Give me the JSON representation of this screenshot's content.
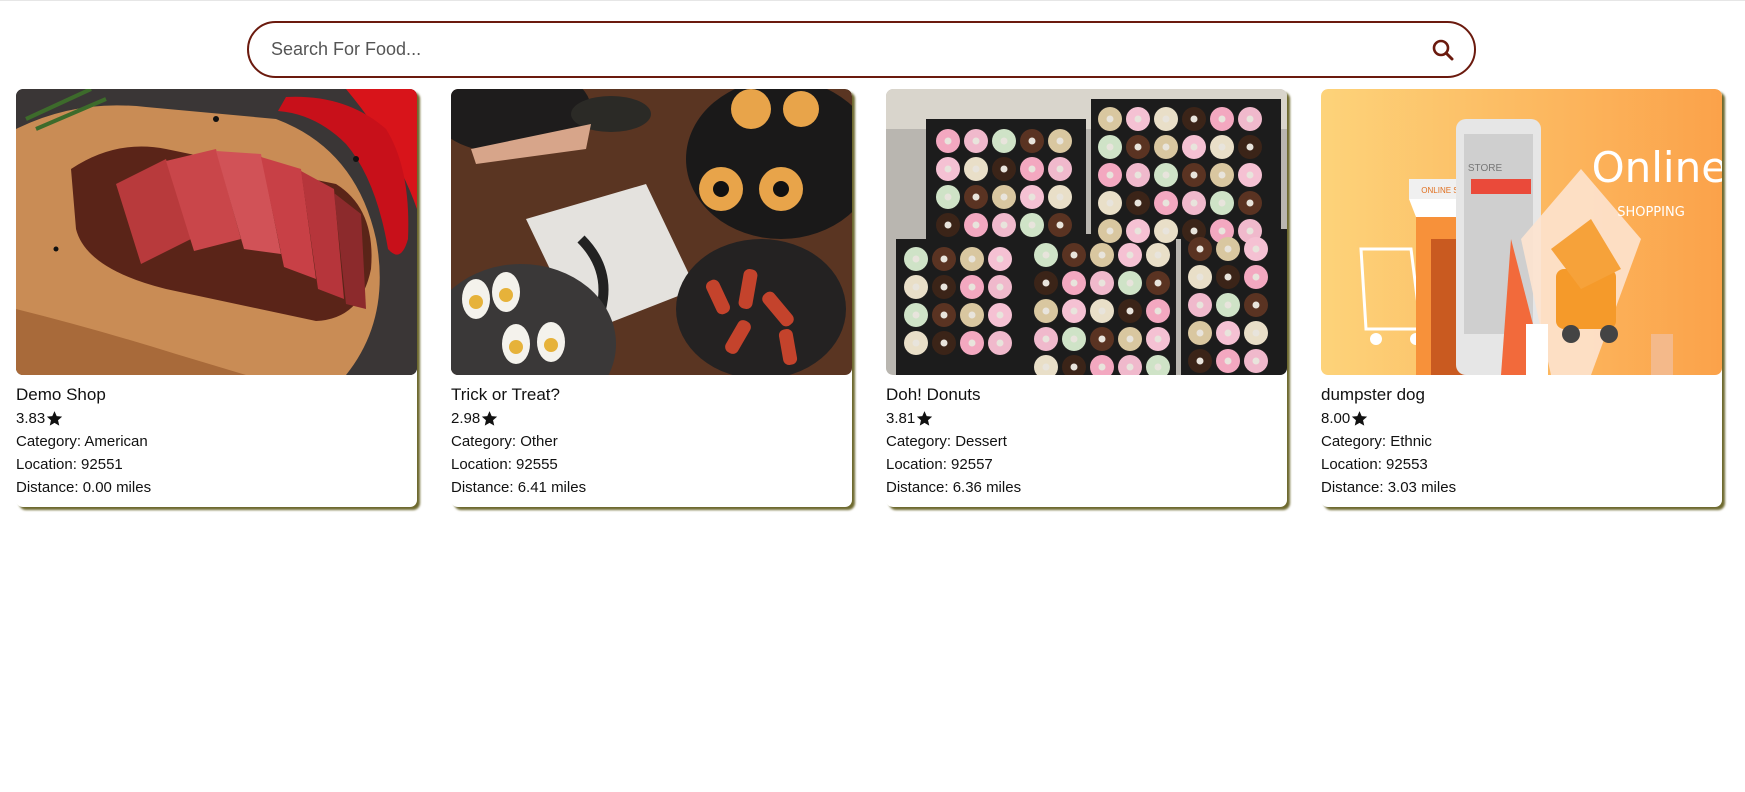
{
  "search": {
    "placeholder": "Search For Food..."
  },
  "labels": {
    "category_prefix": "Category: ",
    "location_prefix": "Location: ",
    "distance_prefix": "Distance: "
  },
  "cards": [
    {
      "name": "Demo Shop",
      "rating": "3.83",
      "category": "American",
      "location": "92551",
      "distance": "0.00 miles",
      "image": "sliced-steak-photo"
    },
    {
      "name": "Trick or Treat?",
      "rating": "2.98",
      "category": "Other",
      "location": "92555",
      "distance": "6.41 miles",
      "image": "halloween-food-photo"
    },
    {
      "name": "Doh! Donuts",
      "rating": "3.81",
      "category": "Dessert",
      "location": "92557",
      "distance": "6.36 miles",
      "image": "donut-trays-photo"
    },
    {
      "name": "dumpster dog",
      "rating": "8.00",
      "category": "Ethnic",
      "location": "92553",
      "distance": "3.03 miles",
      "image": "online-shopping-banner",
      "banner_text": {
        "title": "Online.",
        "subtitle": "SHOPPING",
        "store_sign": "ONLINE STORE",
        "store_sign2": "STORE"
      }
    }
  ],
  "colors": {
    "search_border": "#6b1a0e",
    "card_shadow": "#6e6a2f"
  }
}
